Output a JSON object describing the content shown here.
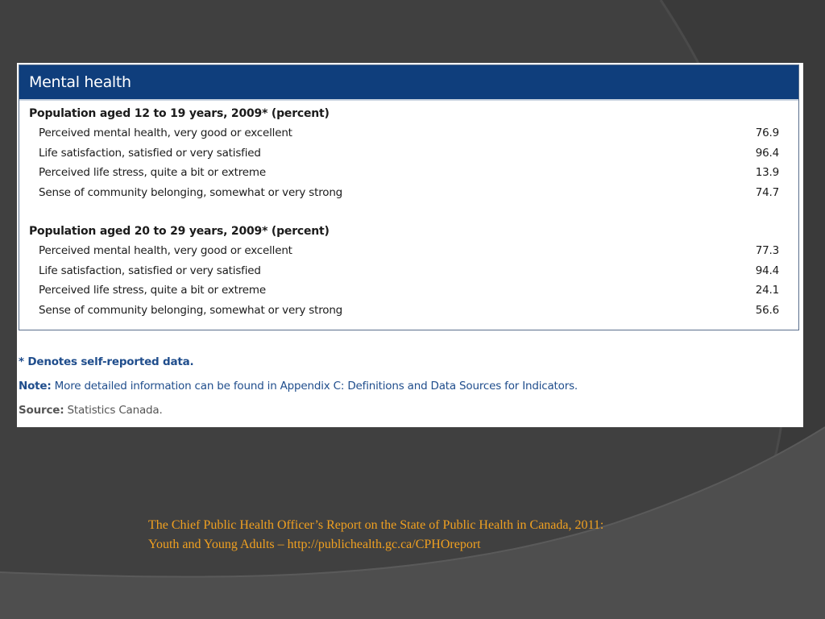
{
  "table": {
    "title": "Mental health",
    "sections": [
      {
        "heading": "Population aged 12 to 19 years, 2009* (percent)",
        "rows": [
          {
            "label": "Perceived mental health, very good or excellent",
            "value": "76.9"
          },
          {
            "label": "Life satisfaction, satisfied or very satisfied",
            "value": "96.4"
          },
          {
            "label": "Perceived life stress, quite a bit or extreme",
            "value": "13.9"
          },
          {
            "label": "Sense of community belonging, somewhat or very strong",
            "value": "74.7"
          }
        ]
      },
      {
        "heading": "Population aged 20 to 29 years, 2009* (percent)",
        "rows": [
          {
            "label": "Perceived mental health, very good or excellent",
            "value": "77.3"
          },
          {
            "label": "Life satisfaction, satisfied or very satisfied",
            "value": "94.4"
          },
          {
            "label": "Perceived life stress, quite a bit or extreme",
            "value": "24.1"
          },
          {
            "label": "Sense of community belonging, somewhat or very strong",
            "value": "56.6"
          }
        ]
      }
    ]
  },
  "notes": {
    "denotes": "* Denotes self-reported data.",
    "note_key": "Note:",
    "note_text": " More detailed information can be found in Appendix C: Definitions and Data Sources for Indicators.",
    "source_key": "Source:",
    "source_text": " Statistics Canada."
  },
  "caption": {
    "line1": "The Chief Public Health Officer’s Report on the State of Public Health in Canada, 2011:",
    "line2": "Youth and Young Adults – http://publichealth.gc.ca/CPHOreport"
  },
  "colors": {
    "header_bg": "#0f3e7c",
    "note_text": "#1f4d8c",
    "caption_text": "#f0a020",
    "slide_bg": "#3a3a3a"
  }
}
